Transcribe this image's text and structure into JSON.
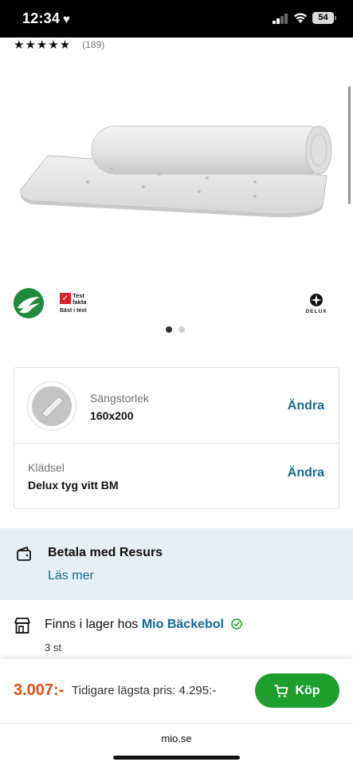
{
  "status_bar": {
    "time": "12:34",
    "battery": "54"
  },
  "rating": {
    "stars": "★★★★★",
    "count": "(189)",
    "value": 4.5
  },
  "logos": {
    "testfakta_mark": "✓",
    "testfakta_name": "Test fakta",
    "testfakta_sub": "Bäst i test",
    "delux_text": "DELUX"
  },
  "gallery": {
    "pages": 2,
    "current": 1
  },
  "options": {
    "size_label": "Sängstorlek",
    "size_value": "160x200",
    "fabric_label": "Klädsel",
    "fabric_value": "Delux tyg vitt BM",
    "change_label": "Ändra"
  },
  "resurs": {
    "title": "Betala med Resurs",
    "link": "Läs mer"
  },
  "stock": {
    "prefix": "Finns i lager hos",
    "store": "Mio Bäckebol",
    "qty": "3 st"
  },
  "buy_bar": {
    "price": "3.007:-",
    "previous_price": "Tidigare lägsta pris: 4.295:-",
    "buy_label": "Köp"
  },
  "browser": {
    "url": "mio.se"
  },
  "colors": {
    "accent_link": "#1a6a93",
    "price": "#e2501c",
    "buy_button": "#1e9e2d",
    "banner_bg": "#e4f0f6"
  }
}
